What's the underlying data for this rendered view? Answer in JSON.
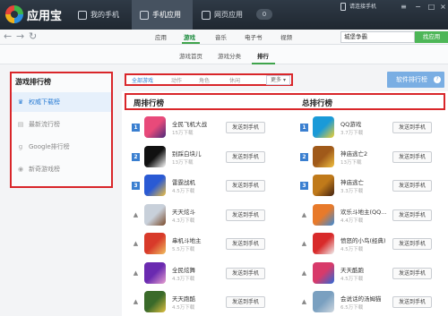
{
  "app": {
    "title": "应用宝"
  },
  "titlebar": {
    "tabs": [
      {
        "label": "我的手机"
      },
      {
        "label": "手机应用"
      },
      {
        "label": "网页应用"
      }
    ],
    "tab_count": "0",
    "login_hint": "请连接手机"
  },
  "nav": {
    "tabs": [
      "应用",
      "游戏",
      "音乐",
      "电子书",
      "视频"
    ],
    "active": "游戏",
    "search_value": "城堡争霸",
    "search_button": "找应用"
  },
  "subnav": {
    "tabs": [
      "游戏首页",
      "游戏分类",
      "排行"
    ],
    "active": "排行"
  },
  "sidebar": {
    "title": "游戏排行榜",
    "items": [
      {
        "label": "权威下载榜",
        "icon": "crown-icon"
      },
      {
        "label": "最新流行榜",
        "icon": "chart-icon"
      },
      {
        "label": "Google排行榜",
        "icon": "google-icon"
      },
      {
        "label": "新奇游戏榜",
        "icon": "bulb-icon"
      }
    ]
  },
  "filters": {
    "items": [
      "全部游戏",
      "动作",
      "角色",
      "休闲"
    ],
    "active": "全部游戏",
    "more": "更多"
  },
  "rank_button": "软件排行榜",
  "columns": {
    "weekly": "周排行榜",
    "total": "总排行榜"
  },
  "send_label": "发送到手机",
  "weekly": [
    {
      "rank": "1",
      "name": "全民飞机大战",
      "meta": "15万下载",
      "colors": [
        "#e84a7a",
        "#4a2a7a"
      ]
    },
    {
      "rank": "2",
      "name": "别踩白块儿",
      "meta": "13万下载",
      "colors": [
        "#111111",
        "#ffffff"
      ]
    },
    {
      "rank": "3",
      "name": "雷霆战机",
      "meta": "4.5万下载",
      "colors": [
        "#2a5ad4",
        "#f0c040"
      ]
    },
    {
      "rank": "4",
      "name": "天天炫斗",
      "meta": "4.3万下载",
      "colors": [
        "#c8d0da",
        "#7a4a2a"
      ]
    },
    {
      "rank": "5",
      "name": "串机斗地主",
      "meta": "5.5万下载",
      "colors": [
        "#d83a2a",
        "#f0c060"
      ]
    },
    {
      "rank": "6",
      "name": "全民炫舞",
      "meta": "4.3万下载",
      "colors": [
        "#6a2ab0",
        "#e8a0d0"
      ]
    },
    {
      "rank": "7",
      "name": "天天跑酷",
      "meta": "4.5万下载",
      "colors": [
        "#3a6a2a",
        "#e0c040"
      ]
    }
  ],
  "total": [
    {
      "rank": "1",
      "name": "QQ游戏",
      "meta": "3.7万下载",
      "colors": [
        "#1a9ad8",
        "#f0d030"
      ]
    },
    {
      "rank": "2",
      "name": "神庙逃亡2",
      "meta": "13万下载",
      "colors": [
        "#a05a1a",
        "#f0c040"
      ]
    },
    {
      "rank": "3",
      "name": "神庙逃亡",
      "meta": "3.3万下载",
      "colors": [
        "#c07a1a",
        "#402010"
      ]
    },
    {
      "rank": "4",
      "name": "欢乐斗地主(QQ...",
      "meta": "4.4万下载",
      "colors": [
        "#e87a2a",
        "#3a8ad8"
      ]
    },
    {
      "rank": "5",
      "name": "愤怒的小鸟(经典)",
      "meta": "4.5万下载",
      "colors": [
        "#d82a2a",
        "#f0f0f0"
      ]
    },
    {
      "rank": "6",
      "name": "天天酷跑",
      "meta": "4.5万下载",
      "colors": [
        "#d83a6a",
        "#2a6ad8"
      ]
    },
    {
      "rank": "7",
      "name": "会说话的汤姆猫",
      "meta": "6.5万下载",
      "colors": [
        "#7aa0c0",
        "#d0d8e0"
      ]
    }
  ]
}
